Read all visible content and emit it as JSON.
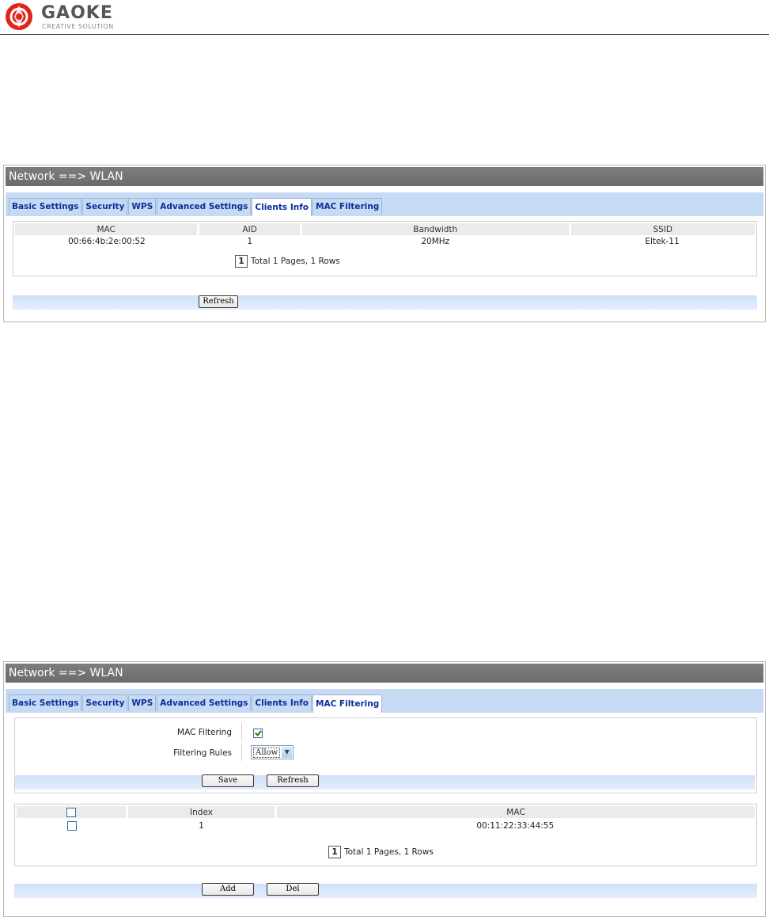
{
  "header": {
    "brand": "GAOKE",
    "tagline": "CREATIVE SOLUTION",
    "brand_color": "#e2231a"
  },
  "panel1": {
    "title": "Network ==> WLAN",
    "tabs": [
      "Basic Settings",
      "Security",
      "WPS",
      "Advanced Settings",
      "Clients Info",
      "MAC Filtering"
    ],
    "active_tab": "Clients Info",
    "table": {
      "columns": [
        "MAC",
        "AID",
        "Bandwidth",
        "SSID"
      ],
      "rows": [
        {
          "mac": "00:66:4b:2e:00:52",
          "aid": "1",
          "bandwidth": "20MHz",
          "ssid": "Eltek-11"
        }
      ]
    },
    "pager": {
      "page": "1",
      "summary": "Total 1 Pages, 1 Rows"
    },
    "refresh_label": "Refresh"
  },
  "panel2": {
    "title": "Network ==> WLAN",
    "tabs": [
      "Basic Settings",
      "Security",
      "WPS",
      "Advanced Settings",
      "Clients Info",
      "MAC Filtering"
    ],
    "active_tab": "MAC Filtering",
    "form": {
      "mac_filtering_label": "MAC Filtering",
      "mac_filtering_checked": true,
      "filtering_rules_label": "Filtering Rules",
      "filtering_rules_value": "Allow",
      "save_label": "Save",
      "refresh_label": "Refresh"
    },
    "table": {
      "columns": [
        "Index",
        "MAC"
      ],
      "rows": [
        {
          "index": "1",
          "mac": "00:11:22:33:44:55"
        }
      ]
    },
    "pager": {
      "page": "1",
      "summary": "Total 1 Pages, 1 Rows"
    },
    "add_label": "Add",
    "del_label": "Del"
  }
}
